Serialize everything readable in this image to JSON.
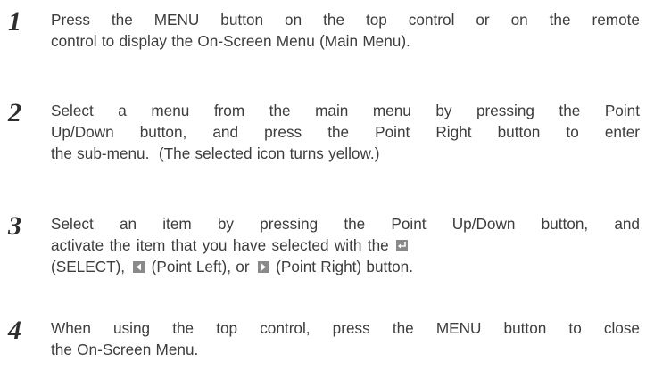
{
  "steps": [
    {
      "number": "1",
      "lines": [
        "Press the MENU button on the top control or on the remote",
        "control to display the On-Screen Menu (Main Menu)."
      ]
    },
    {
      "number": "2",
      "lines": [
        "Select a menu from the main menu by pressing the Point",
        "Up/Down button, and press the Point Right button to enter",
        "the sub-menu.  (The selected icon turns yellow.)"
      ]
    },
    {
      "number": "3",
      "line1": "Select an item by pressing the Point Up/Down button, and",
      "line2_text": "activate the item that you have selected with the",
      "line3_select": "(SELECT),",
      "line3_left": "(Point Left), or",
      "line3_right": "(Point Right) button."
    },
    {
      "number": "4",
      "lines": [
        "When using the top control, press the MENU button to close",
        "the On-Screen Menu."
      ]
    }
  ],
  "icons": {
    "select": "select-enter-icon",
    "left": "point-left-icon",
    "right": "point-right-icon"
  },
  "colors": {
    "text": "#3d3d3d",
    "number": "#2e2e2e",
    "icon_bg": "#8a8a8a"
  }
}
